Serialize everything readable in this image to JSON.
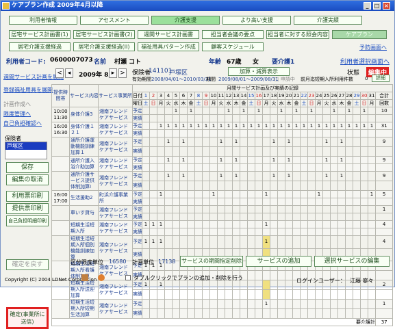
{
  "window": {
    "title": "ケアプラン作成 2009年4月以降"
  },
  "menu": {
    "row1": [
      "利用者情報",
      "アセスメント",
      "介護支援",
      "より高い支援",
      "介護実績"
    ],
    "row2": [
      "居宅サービス計画書(1)",
      "居宅サービス計画書(2)",
      "週間サービス計画書",
      "担当者会議の要点",
      "担当者に対する照会内容",
      "ケアプラン"
    ],
    "row3": [
      "居宅介護支援経過",
      "居宅介護支援経過(II)",
      "福祉用具パターン作成",
      "顧客スケジュール"
    ],
    "link": "予防画面へ"
  },
  "info": {
    "code_label": "利用者コード:",
    "code": "0600007073",
    "name_label": "名前",
    "name": "村瀬 コト",
    "age_label": "年齢",
    "age": "67歳",
    "sex": "女",
    "care_label": "要介護1",
    "back_link": "利用者選択画面へ"
  },
  "sidebar": {
    "links": [
      "週間サービス計画を展開",
      "登録福祉用具を展開",
      "計画作成へ",
      "限度管理へ",
      "自己負担確認へ"
    ],
    "insurer_label": "保険者",
    "insurer_value": "戸塚区",
    "buttons": [
      "保存",
      "編集の取消",
      "利用票印刷",
      "提供票印刷",
      "自己負担明細印刷"
    ],
    "confirm": "確定(事業所に送信)",
    "back": "確定を戻す"
  },
  "toolbar": {
    "month": "2009年 8月",
    "insurer_label": "保険者",
    "insurer_no": "141101",
    "insurer_name": "戸塚区",
    "add_button": "加算・減算表示",
    "status_label": "状態",
    "status_value": "編集中",
    "period_label": "有効期間",
    "period": "2008/04/01〜2010/03/31",
    "period2_label": "期間",
    "period2": "2009/08/01〜2009/08/31",
    "check_label": "□ 申請中",
    "month_count_label": "前月迄短期入所利用件数",
    "month_count": "0",
    "detail": "詳細"
  },
  "table": {
    "headers": [
      "提供時間帯",
      "サービス内容",
      "サービス事業所"
    ],
    "days_label": "月間サービス計画及び実績の記録",
    "day_row_label": "日付",
    "week_row_label": "曜日",
    "total_label": "合計",
    "times_label": "回数",
    "weekdays": [
      "土",
      "日",
      "月",
      "火",
      "水",
      "木",
      "金",
      "土",
      "日",
      "月",
      "火",
      "水",
      "木",
      "金",
      "土",
      "日",
      "月",
      "火",
      "水",
      "木",
      "金",
      "土",
      "日",
      "月",
      "火",
      "水",
      "木",
      "金",
      "土",
      "日",
      "月"
    ],
    "kubun": [
      "予定",
      "実績"
    ],
    "rows": [
      {
        "time": "10:00 11:30",
        "svc": "身体介護3",
        "biz": "湘南フレンドケアサービス",
        "marks": [
          5,
          7,
          12,
          14,
          16,
          19,
          21,
          23,
          26,
          28,
          30
        ],
        "total": "10"
      },
      {
        "time": "16:00 16:30",
        "svc": "身体介護１２１",
        "biz": "湘南フレンドケアサービス",
        "marks": [
          3,
          4,
          5,
          6,
          7,
          8,
          9,
          10,
          11,
          12,
          13,
          14,
          15,
          16,
          17,
          18,
          19,
          20,
          21,
          22,
          23,
          24,
          25,
          26,
          27,
          28,
          29,
          30,
          31
        ],
        "total": "31"
      },
      {
        "time": "",
        "svc": "通所介護運動機能訓練加算１",
        "biz": "湘南フレンドケアサービス",
        "marks": [
          4,
          6,
          11,
          13,
          18,
          20,
          25,
          27
        ],
        "total": "9"
      },
      {
        "time": "",
        "svc": "通所介護入浴介助加算",
        "biz": "湘南フレンドケアサービス",
        "marks": [
          4,
          6,
          11,
          13,
          18,
          20,
          25,
          27
        ],
        "total": "9"
      },
      {
        "time": "",
        "svc": "通所介護サービス提供体制加算Ⅰ",
        "biz": "湘南フレンドケアサービス",
        "marks": [
          4,
          6,
          11,
          13,
          18,
          20,
          25,
          27
        ],
        "total": "9"
      },
      {
        "time": "16:00 17:00",
        "svc": "生活援助2",
        "biz": "町浜介護事業所",
        "marks": [
          3,
          10,
          17,
          24,
          31
        ],
        "total": "5"
      },
      {
        "time": "",
        "svc": "車いす貸与",
        "biz": "湘南フレンドケアサービス",
        "marks": [],
        "total": "1"
      },
      {
        "time": "",
        "svc": "短期生活短期入所",
        "biz": "湘南フレンドケアサービス",
        "marks": [
          1,
          2,
          3,
          17
        ],
        "total": "4"
      },
      {
        "time": "",
        "svc": "短期生活短期入所個別機能訓練加算",
        "biz": "湘南フレンドケアサービス",
        "marks": [
          1,
          2,
          3,
          17
        ],
        "total": "4"
      },
      {
        "time": "",
        "svc": "短期生活短期入所看護体制加算",
        "biz": "湘南フレンドケアサービス",
        "marks": [
          1,
          2,
          3,
          17
        ],
        "total": "4"
      },
      {
        "time": "",
        "svc": "短期生活短期入所送迎加算",
        "biz": "湘南フレンドケアサービス",
        "marks": [
          1,
          3
        ],
        "total": "2"
      },
      {
        "time": "",
        "svc": "短期生活短期入所短期生活加算",
        "biz": "湘南フレンドケアサービス",
        "marks": [
          17
        ],
        "total": "1"
      }
    ],
    "footer_total_label": "要介護計",
    "footer_total": "37"
  },
  "bottom": {
    "kubun_label": "区分限度単位",
    "kubun_value": "16580",
    "plan_label": "計画単位",
    "plan_value": "17138",
    "b1": "サービスの期間指定削除",
    "b2": "サービスの追加",
    "b3": "選択サービスの編集",
    "check": "ダブルクリックでプランの追加・削除を行う"
  },
  "footer": {
    "copyright": "Copyright (C) 2004 LDNet Corporation",
    "login_label": "ログインユーザー：",
    "login_user": "江藤 寧々"
  }
}
